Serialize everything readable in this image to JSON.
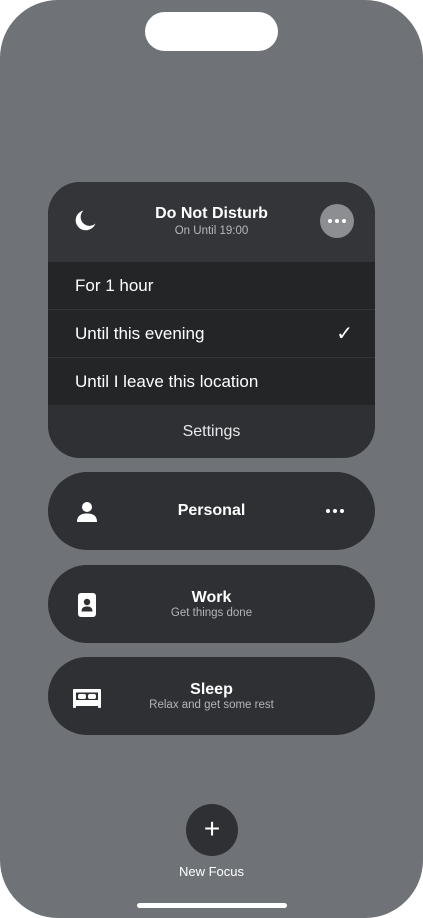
{
  "dnd": {
    "icon": "moon-icon",
    "title": "Do Not Disturb",
    "subtitle": "On Until 19:00",
    "options": [
      {
        "label": "For 1 hour",
        "selected": false
      },
      {
        "label": "Until this evening",
        "selected": true,
        "check": "✓"
      },
      {
        "label": "Until I leave this location",
        "selected": false
      }
    ],
    "settings_label": "Settings"
  },
  "focuses": [
    {
      "title": "Personal",
      "icon": "person-icon"
    },
    {
      "title": "Work",
      "subtitle": "Get things done",
      "icon": "id-badge-icon"
    },
    {
      "title": "Sleep",
      "subtitle": "Relax and get some rest",
      "icon": "bed-icon"
    }
  ],
  "new_focus": {
    "symbol": "+",
    "label": "New Focus"
  },
  "colors": {
    "background": "#6f7277",
    "card": "#2e3033",
    "options": "#232527"
  }
}
